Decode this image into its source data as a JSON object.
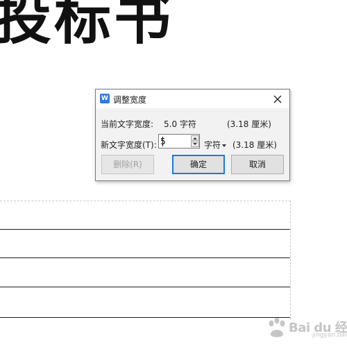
{
  "document": {
    "title_fragment": "投标书"
  },
  "dialog": {
    "app_icon_letter": "W",
    "title": "调整宽度",
    "current_label": "当前文字宽度:",
    "current_value": "5.0 字符",
    "current_cm": "(3.18 厘米)",
    "new_label": "新文字宽度(T):",
    "new_value": "5",
    "unit": "字符",
    "new_cm": "(3.18 厘米)",
    "delete_label": "删除(R)",
    "ok_label": "确定",
    "cancel_label": "取消"
  },
  "watermark": {
    "text": "Bai du 经验",
    "sub": "jingyan.baidu.com"
  },
  "icons": {
    "app": "wps-writer-icon",
    "close": "close-icon",
    "spin_up": "spin-up-icon",
    "spin_down": "spin-down-icon",
    "dropdown": "chevron-down-icon"
  },
  "colors": {
    "accent": "#1d79d2",
    "app_icon": "#2d7ce0",
    "dialog_bg": "#f2f2f2"
  }
}
